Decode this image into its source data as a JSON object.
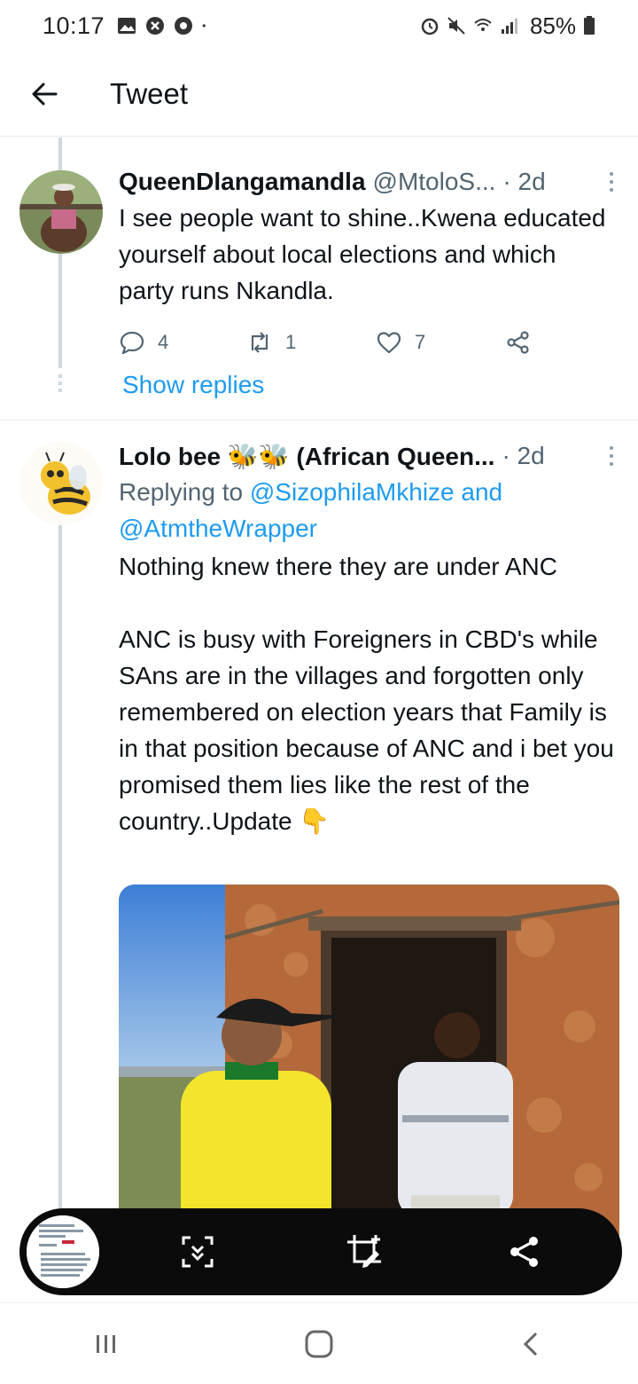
{
  "status_bar": {
    "time": "10:17",
    "battery": "85%"
  },
  "header": {
    "title": "Tweet"
  },
  "tweets": [
    {
      "display_name": "QueenDlangamandla",
      "handle": "@MtoloS...",
      "time": "· 2d",
      "text": "I see people want to shine..Kwena educated yourself about local elections and which party runs Nkandla.",
      "reply_count": "4",
      "retweet_count": "1",
      "like_count": "7",
      "show_replies": "Show replies"
    },
    {
      "display_name": "Lolo bee 🐝🐝 (African Queen...",
      "time": "· 2d",
      "replying_prefix": "Replying to",
      "replying_users_1": "@SizophilaMkhize and",
      "replying_users_2": "@AtmtheWrapper",
      "text": "Nothing knew there they are under ANC\n\nANC is busy with Foreigners in CBD's while SAns are in the villages and forgotten only remembered on election years that Family is in that position because of ANC and i bet you promised them lies like the rest of the country..Update 👇"
    }
  ],
  "icons": {
    "back": "arrow-left-icon",
    "reply": "comment-icon",
    "retweet": "retweet-icon",
    "like": "heart-icon",
    "share": "share-icon",
    "more": "more-vertical-icon"
  },
  "colors": {
    "link": "#1d9bf0",
    "secondary_text": "#536471",
    "toolbar_bg": "#0b0b0b"
  }
}
